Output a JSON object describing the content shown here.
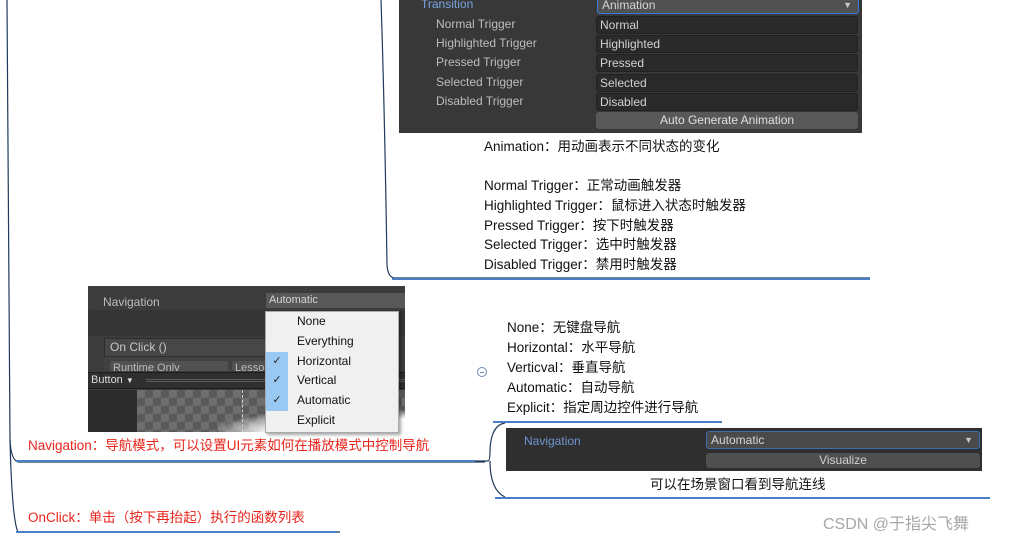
{
  "transition_panel": {
    "transition_label": "Transition",
    "transition_value": "Animation",
    "rows": [
      {
        "label": "Normal Trigger",
        "value": "Normal"
      },
      {
        "label": "Highlighted Trigger",
        "value": "Highlighted"
      },
      {
        "label": "Pressed Trigger",
        "value": "Pressed"
      },
      {
        "label": "Selected Trigger",
        "value": "Selected"
      },
      {
        "label": "Disabled Trigger",
        "value": "Disabled"
      }
    ],
    "auto_generate_button": "Auto Generate Animation"
  },
  "animation_notes": {
    "intro": "Animation：用动画表示不同状态的变化",
    "lines": [
      "Normal Trigger：正常动画触发器",
      "Highlighted Trigger：鼠标进入状态时触发器",
      "Pressed Trigger：按下时触发器",
      "Selected Trigger：选中时触发器",
      "Disabled Trigger：禁用时触发器"
    ]
  },
  "navigation_panel": {
    "label": "Navigation",
    "value": "Automatic",
    "onclick_label": "On Click ()",
    "runtime_value": "Runtime Only",
    "object_value": "Lesso",
    "button_tab": "Button",
    "menu": [
      {
        "label": "None",
        "checked": false
      },
      {
        "label": "Everything",
        "checked": false
      },
      {
        "label": "Horizontal",
        "checked": true
      },
      {
        "label": "Vertical",
        "checked": true
      },
      {
        "label": "Automatic",
        "checked": true
      },
      {
        "label": "Explicit",
        "checked": false
      }
    ]
  },
  "navigation_notes": {
    "lines": [
      "None：无键盘导航",
      "Horizontal：水平导航",
      "Verticval：垂直导航",
      "Automatic：自动导航",
      "Explicit：指定周边控件进行导航"
    ]
  },
  "visualize_panel": {
    "label": "Navigation",
    "value": "Automatic",
    "button": "Visualize",
    "caption": "可以在场景窗口看到导航连线"
  },
  "topics": {
    "navigation": "Navigation：导航模式，可以设置UI元素如何在播放模式中控制导航",
    "onclick": "OnClick：单击（按下再抬起）执行的函数列表"
  },
  "watermark": "CSDN @于指尖飞舞",
  "colors": {
    "branch_line": "#4a7fc8",
    "connector": "#1f3a5a",
    "topic_red": "#e8251c",
    "unity_bg": "#383838",
    "check_highlight": "#99c9f3"
  }
}
